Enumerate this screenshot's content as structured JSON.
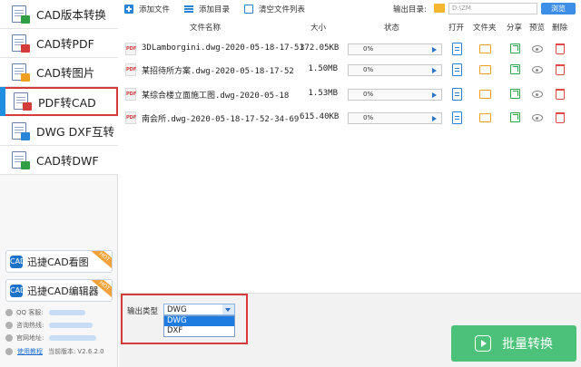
{
  "sidebar": {
    "items": [
      {
        "label": "CAD版本转换",
        "icon": "cad-version-icon",
        "color": "#2f9e44"
      },
      {
        "label": "CAD转PDF",
        "icon": "cad-to-pdf-icon",
        "color": "#d43c3c"
      },
      {
        "label": "CAD转图片",
        "icon": "cad-to-image-icon",
        "color": "#f0a020"
      },
      {
        "label": "PDF转CAD",
        "icon": "pdf-to-cad-icon",
        "color": "#d43c3c"
      },
      {
        "label": "DWG DXF互转",
        "icon": "dwg-dxf-icon",
        "color": "#2b83d8"
      },
      {
        "label": "CAD转DWF",
        "icon": "cad-to-dwf-icon",
        "color": "#2f9e44"
      }
    ],
    "active_index": 3,
    "promos": [
      {
        "label": "迅捷CAD看图",
        "badge": "HOT"
      },
      {
        "label": "迅捷CAD编辑器",
        "badge": "HOT"
      }
    ],
    "info": {
      "qq_label": "QQ 客服:",
      "hotline_label": "咨询热线:",
      "website_label": "官网地址:",
      "tutorial_link": "使用教程",
      "version_label": "当前版本:",
      "version": "V2.6.2.0"
    }
  },
  "toolbar": {
    "add_file": "添加文件",
    "add_dir": "添加目录",
    "clear_list": "清空文件列表",
    "output_dir_label": "输出目录:",
    "output_dir_value": "D:\\ZM",
    "browse": "浏览"
  },
  "table": {
    "headers": {
      "name": "文件名称",
      "size": "大小",
      "status": "状态",
      "open": "打开",
      "folder": "文件夹",
      "share": "分享",
      "preview": "预览",
      "delete": "删除"
    },
    "rows": [
      {
        "name": "3DLamborgini.dwg-2020-05-18-17-51",
        "size": "372.05KB",
        "progress_text": "0%",
        "progress": 0
      },
      {
        "name": "某招待所方案.dwg-2020-05-18-17-52",
        "size": "1.50MB",
        "progress_text": "0%",
        "progress": 0
      },
      {
        "name": "某综合楼立面施工图.dwg-2020-05-18",
        "size": "1.53MB",
        "progress_text": "0%",
        "progress": 0
      },
      {
        "name": "南会所.dwg-2020-05-18-17-52-34-69",
        "size": "615.40KB",
        "progress_text": "0%",
        "progress": 0
      }
    ]
  },
  "output_type": {
    "label": "输出类型",
    "selected": "DWG",
    "options": [
      "DWG",
      "DXF"
    ]
  },
  "convert_button": "批量转换",
  "colors": {
    "accent": "#1f8de0",
    "highlight": "#d63a3a",
    "convert": "#4bc17a"
  }
}
